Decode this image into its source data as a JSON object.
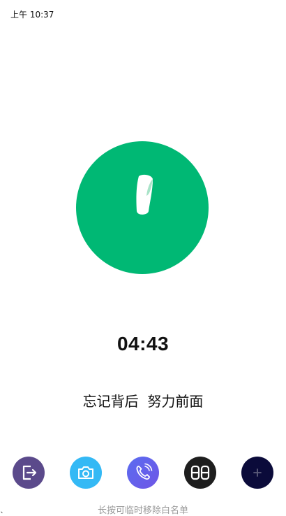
{
  "status_bar": {
    "time": "上午 10:37"
  },
  "focus": {
    "accent_color": "#00b874",
    "icon": "leaf-sprout-icon"
  },
  "timer": {
    "value": "04:43"
  },
  "motto": {
    "text": "忘记背后  努力前面"
  },
  "dock": {
    "buttons": [
      {
        "icon": "exit-icon",
        "color": "#5b4a8b"
      },
      {
        "icon": "camera-icon",
        "color": "#34b9f5"
      },
      {
        "icon": "phone-call-icon",
        "color": "#6366f1"
      },
      {
        "icon": "digital-clock-icon",
        "color": "#1e1e1e"
      },
      {
        "icon": "add-icon",
        "color": "#0b0b3a"
      }
    ]
  },
  "hint": {
    "text": "长按可临时移除白名单"
  }
}
